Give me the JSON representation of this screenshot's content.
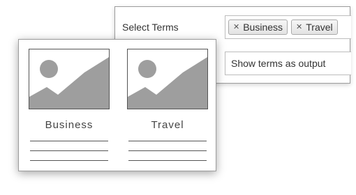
{
  "settings": {
    "select_terms_label": "Select Terms",
    "selected_terms": [
      {
        "label": "Business"
      },
      {
        "label": "Travel"
      }
    ],
    "output_mode_value": "Show terms as output"
  },
  "preview": {
    "cards": [
      {
        "title": "Business",
        "thumbnail_icon": "image-placeholder-icon"
      },
      {
        "title": "Travel",
        "thumbnail_icon": "image-placeholder-icon"
      }
    ]
  },
  "colors": {
    "placeholder_fill": "#9e9e9e",
    "border": "#9c9c9c",
    "text": "#333333"
  }
}
